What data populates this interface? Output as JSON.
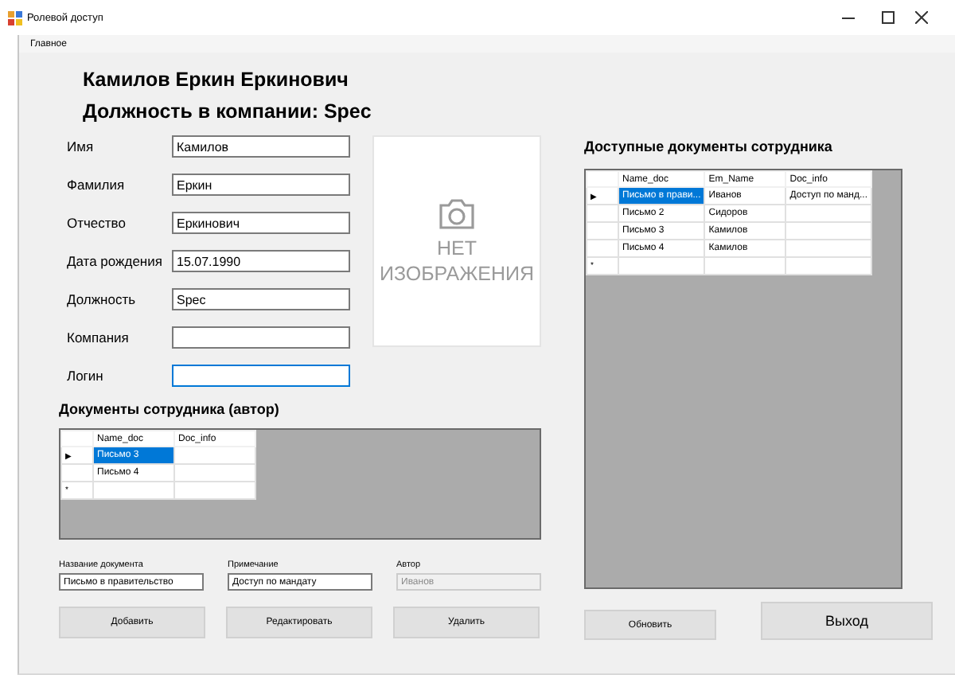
{
  "window": {
    "title": "Ролевой доступ"
  },
  "menu": [
    {
      "label": "Главное"
    }
  ],
  "employee": {
    "full_name": "Камилов Еркин Еркинович",
    "position_line": "Должность в компании: Spec"
  },
  "fields": [
    {
      "label": "Имя",
      "value": "Камилов",
      "focused": false
    },
    {
      "label": "Фамилия",
      "value": "Еркин",
      "focused": false
    },
    {
      "label": "Отчество",
      "value": "Еркинович",
      "focused": false
    },
    {
      "label": "Дата рождения",
      "value": "15.07.1990",
      "focused": false
    },
    {
      "label": "Должность",
      "value": "Spec",
      "focused": false
    },
    {
      "label": "Компания",
      "focused": false
    },
    {
      "label": "Логин",
      "focused": true
    }
  ],
  "photo": {
    "text": "НЕТ ИЗОБРАЖЕНИЯ"
  },
  "author_docs": {
    "title": "Документы сотрудника (автор)",
    "columns": [
      "Name_doc",
      "Doc_info"
    ],
    "rows": [
      {
        "marker": "▶",
        "cells": [
          {
            "text": "Письмо 3",
            "selected": true
          },
          {
            "selected": false
          }
        ]
      },
      {
        "cells": [
          {
            "text": "Письмо 4",
            "selected": false
          },
          {
            "selected": false
          }
        ]
      },
      {
        "marker": "*",
        "cells": [
          {
            "selected": false
          },
          {
            "selected": false
          }
        ]
      }
    ]
  },
  "doc_fields": [
    {
      "label": "Название документа",
      "value": "Письмо в правительство",
      "disabled": false
    },
    {
      "label": "Примечание",
      "value": "Доступ по мандату",
      "disabled": false
    },
    {
      "label": "Автор",
      "value": "Иванов",
      "disabled": true
    }
  ],
  "doc_buttons": [
    "Добавить",
    "Редактировать",
    "Удалить"
  ],
  "available_docs": {
    "title": "Доступные документы сотрудника",
    "columns": [
      "Name_doc",
      "Em_Name",
      "Doc_info"
    ],
    "rows": [
      {
        "marker": "▶",
        "cells": [
          {
            "text": "Письмо в прави...",
            "selected": true
          },
          {
            "text": "Иванов",
            "selected": false
          },
          {
            "text": "Доступ по манд...",
            "selected": false
          }
        ]
      },
      {
        "cells": [
          {
            "text": "Письмо 2",
            "selected": false
          },
          {
            "text": "Сидоров",
            "selected": false
          },
          {
            "selected": false
          }
        ]
      },
      {
        "cells": [
          {
            "text": "Письмо 3",
            "selected": false
          },
          {
            "text": "Камилов",
            "selected": false
          },
          {
            "selected": false
          }
        ]
      },
      {
        "cells": [
          {
            "text": "Письмо 4",
            "selected": false
          },
          {
            "text": "Камилов",
            "selected": false
          },
          {
            "selected": false
          }
        ]
      },
      {
        "marker": "*",
        "cells": [
          {
            "selected": false
          },
          {
            "selected": false
          },
          {
            "selected": false
          }
        ]
      }
    ]
  },
  "refresh_button": "Обновить",
  "exit_button": "Выход"
}
